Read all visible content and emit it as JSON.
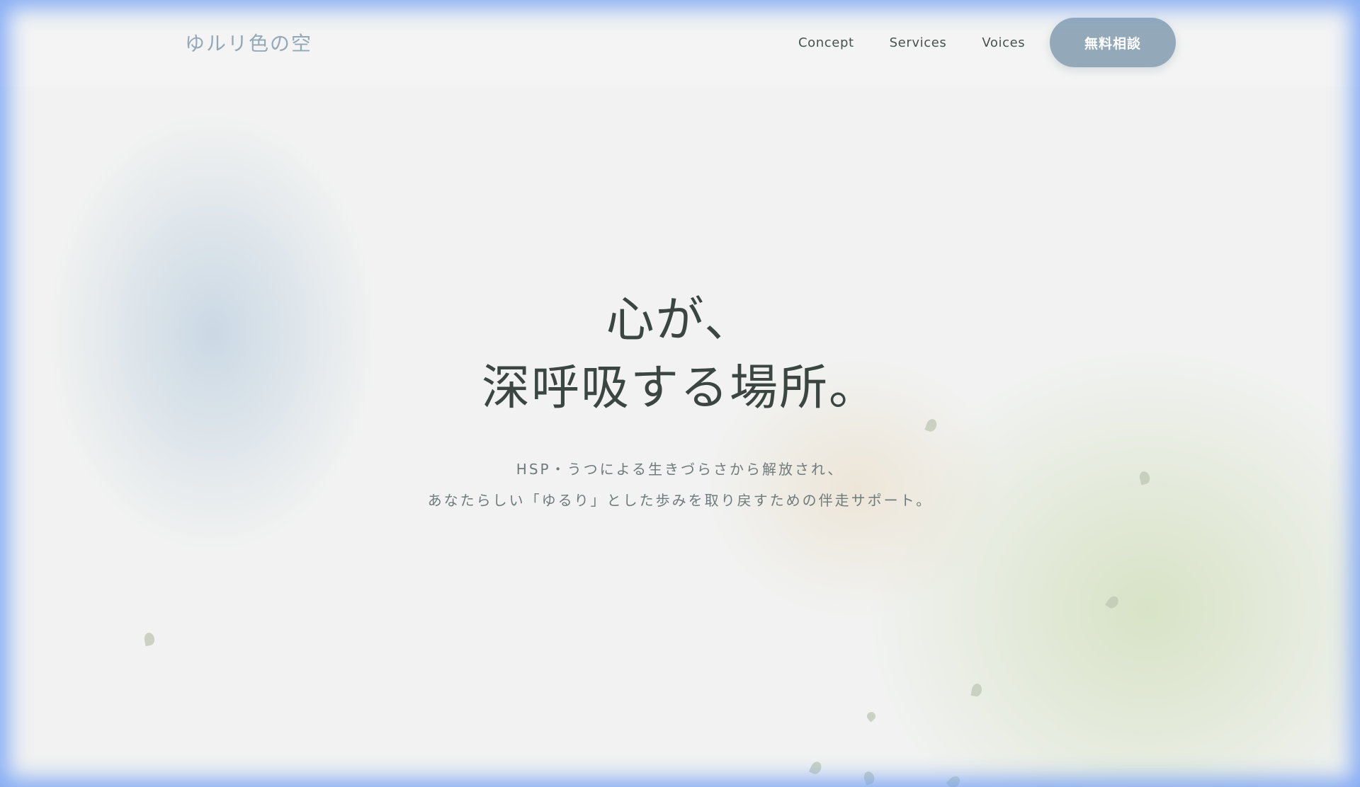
{
  "header": {
    "logo": "ゆルリ色の空",
    "nav": [
      {
        "label": "Concept"
      },
      {
        "label": "Services"
      },
      {
        "label": "Voices"
      }
    ],
    "cta_label": "無料相談"
  },
  "hero": {
    "title_lines": [
      "心が、",
      "深呼吸する場所。"
    ],
    "subtitle_lines": [
      "HSP・うつによる生きづらさから解放され、",
      "あなたらしい「ゆるり」とした歩みを取り戻すための伴走サポート。"
    ]
  },
  "colors": {
    "accent": "#93a9ba",
    "text_dark": "#3b4643",
    "text_muted": "#6f7b7b",
    "background": "#f1f2f1",
    "glow": "#73a0f5"
  }
}
